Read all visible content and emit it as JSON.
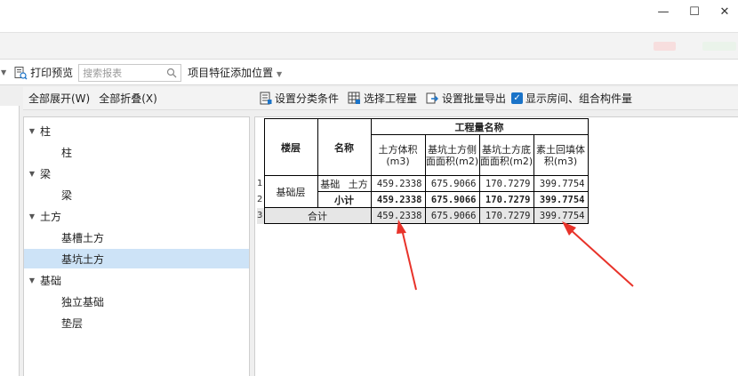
{
  "window": {
    "controls": {
      "minimize": "—",
      "maximize": "☐",
      "close": "✕"
    }
  },
  "toolbar": {
    "print_preview": "打印预览",
    "search_placeholder": "搜索报表",
    "feature_position": "项目特征添加位置"
  },
  "left_panel": {
    "expand_all": "全部展开(W)",
    "collapse_all": "全部折叠(X)",
    "tree": [
      {
        "label": "柱",
        "children": [
          "柱"
        ]
      },
      {
        "label": "梁",
        "children": [
          "梁"
        ]
      },
      {
        "label": "土方",
        "children": [
          "基槽土方",
          "基坑土方"
        ]
      },
      {
        "label": "基础",
        "children": [
          "独立基础",
          "垫层"
        ]
      }
    ],
    "selected": "基坑土方"
  },
  "right_panel": {
    "set_classification": "设置分类条件",
    "select_quantity": "选择工程量",
    "set_batch_export": "设置批量导出",
    "show_rooms_label": "显示房间、组合构件量",
    "show_rooms_checked": true
  },
  "report": {
    "header": {
      "floor": "楼层",
      "name": "名称",
      "quantity_group": "工程量名称",
      "col1": "土方体积(m3)",
      "col2": "基坑土方侧面面积(m2)",
      "col3": "基坑土方底面面积(m2)",
      "col4": "素土回填体积(m3)"
    },
    "row_numbers": [
      "1",
      "2",
      "3"
    ],
    "rows": {
      "floor": "基础层",
      "item": {
        "name": "基础",
        "subname": "土方",
        "values": [
          "459.2338",
          "675.9066",
          "170.7279",
          "399.7754"
        ]
      },
      "subtotal": {
        "name": "小计",
        "values": [
          "459.2338",
          "675.9066",
          "170.7279",
          "399.7754"
        ]
      },
      "total": {
        "name": "合计",
        "values": [
          "459.2338",
          "675.9066",
          "170.7279",
          "399.7754"
        ]
      }
    }
  },
  "colors": {
    "accent": "#1a73c8",
    "selected_row": "#cde3f7",
    "annotation_arrow": "#e8332a"
  }
}
